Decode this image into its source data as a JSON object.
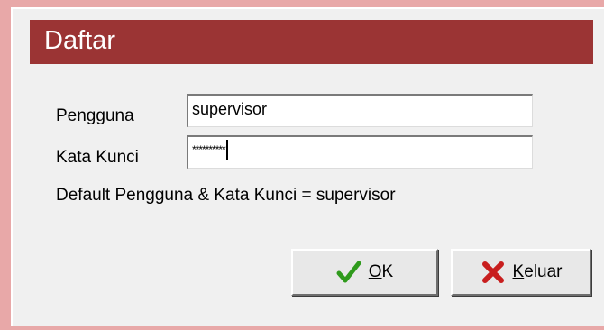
{
  "dialog": {
    "title": "Daftar",
    "username_label": "Pengguna",
    "username_value": "supervisor",
    "password_label": "Kata Kunci",
    "password_mask": "**********",
    "hint": "Default Pengguna & Kata Kunci = supervisor"
  },
  "buttons": {
    "ok": {
      "mnemonic": "O",
      "rest": "K",
      "icon": "checkmark-icon",
      "icon_color": "#2f9a1c"
    },
    "exit": {
      "mnemonic": "K",
      "rest": "eluar",
      "icon": "x-icon",
      "icon_color": "#c81e1e"
    }
  },
  "colors": {
    "banner": "#9b3434",
    "background": "#e8a8a8"
  }
}
